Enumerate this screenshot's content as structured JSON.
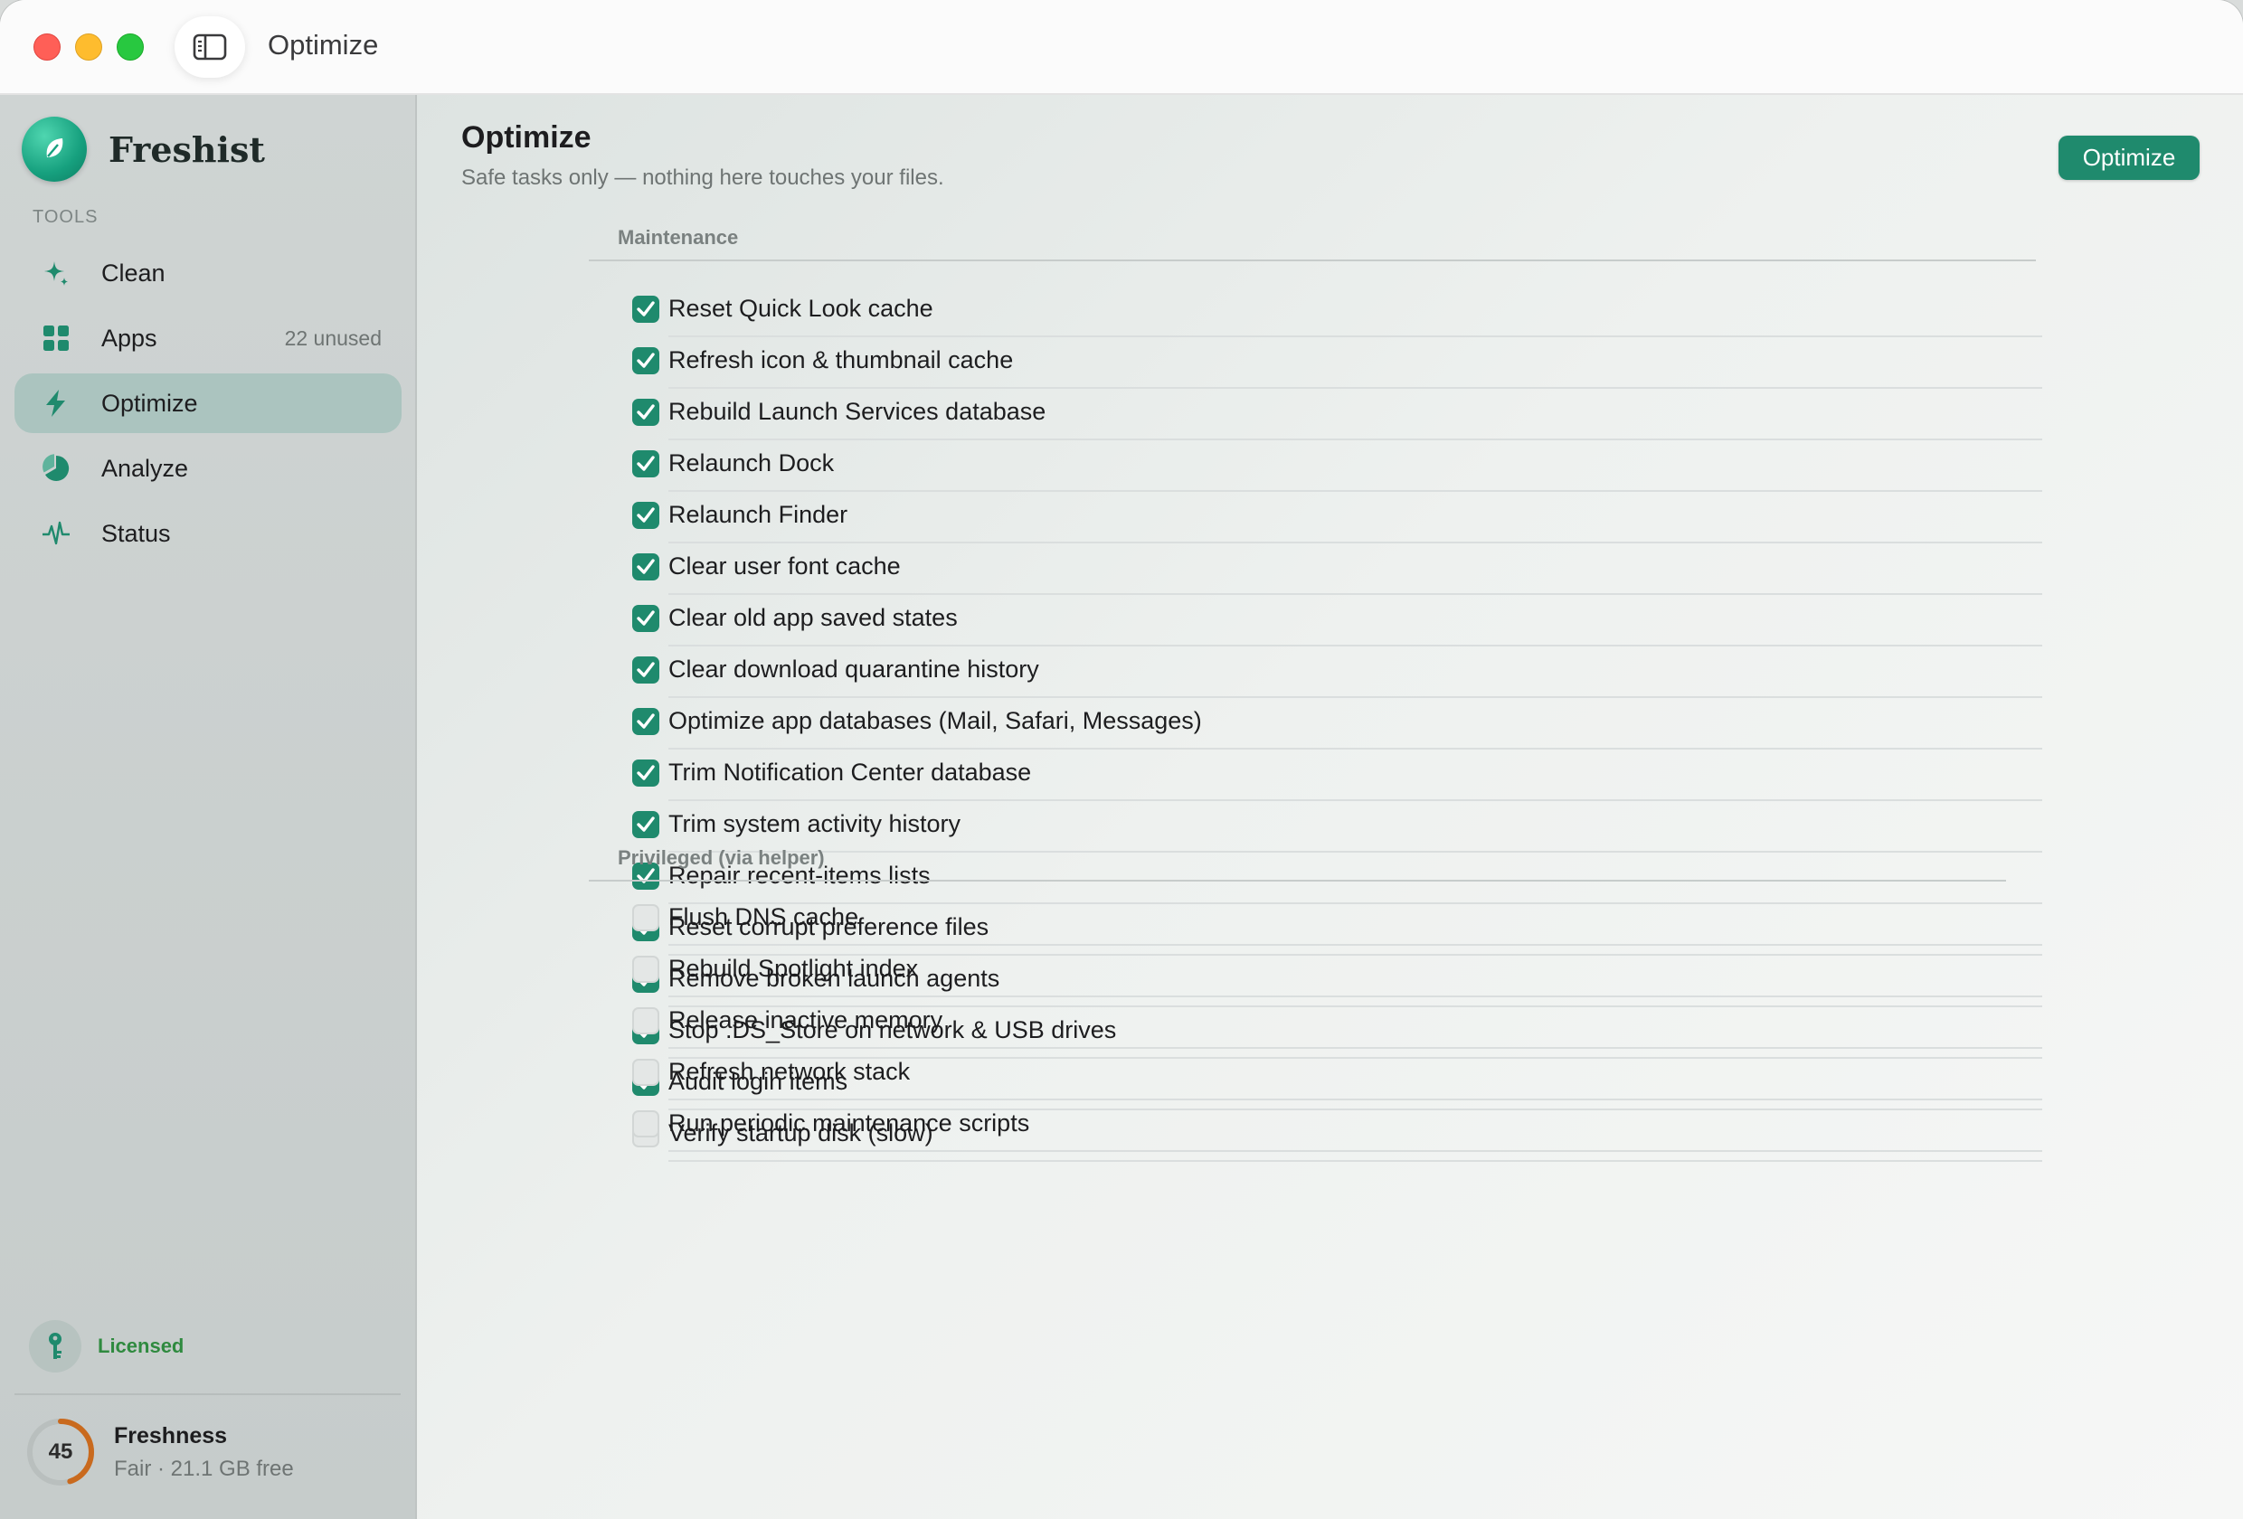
{
  "window": {
    "title": "Optimize"
  },
  "sidebar": {
    "brand": "Freshist",
    "section_label": "TOOLS",
    "items": [
      {
        "label": "Clean",
        "badge": "",
        "icon": "sparkle-icon",
        "active": false
      },
      {
        "label": "Apps",
        "badge": "22 unused",
        "icon": "grid-icon",
        "active": false
      },
      {
        "label": "Optimize",
        "badge": "",
        "icon": "bolt-icon",
        "active": true
      },
      {
        "label": "Analyze",
        "badge": "",
        "icon": "pie-chart-icon",
        "active": false
      },
      {
        "label": "Status",
        "badge": "",
        "icon": "pulse-icon",
        "active": false
      }
    ],
    "license": {
      "label": "Licensed",
      "icon": "key-icon"
    },
    "freshness": {
      "score": "45",
      "score_fraction": 0.45,
      "title": "Freshness",
      "subtitle": "Fair · 21.1 GB free"
    }
  },
  "main": {
    "title": "Optimize",
    "subtitle": "Safe tasks only — nothing here touches your files.",
    "action_label": "Optimize",
    "groups": [
      {
        "header": "Maintenance",
        "tasks": [
          {
            "label": "Reset Quick Look cache",
            "checked": true
          },
          {
            "label": "Refresh icon & thumbnail cache",
            "checked": true
          },
          {
            "label": "Rebuild Launch Services database",
            "checked": true
          },
          {
            "label": "Relaunch Dock",
            "checked": true
          },
          {
            "label": "Relaunch Finder",
            "checked": true
          },
          {
            "label": "Clear user font cache",
            "checked": true
          },
          {
            "label": "Clear old app saved states",
            "checked": true
          },
          {
            "label": "Clear download quarantine history",
            "checked": true
          },
          {
            "label": "Optimize app databases (Mail, Safari, Messages)",
            "checked": true
          },
          {
            "label": "Trim Notification Center database",
            "checked": true
          },
          {
            "label": "Trim system activity history",
            "checked": true
          },
          {
            "label": "Repair recent-items lists",
            "checked": true
          },
          {
            "label": "Reset corrupt preference files",
            "checked": true
          },
          {
            "label": "Remove broken launch agents",
            "checked": true
          },
          {
            "label": "Stop .DS_Store on network & USB drives",
            "checked": true
          },
          {
            "label": "Audit login items",
            "checked": true
          },
          {
            "label": "Verify startup disk (slow)",
            "checked": false
          }
        ]
      },
      {
        "header": "Privileged (via helper)",
        "tasks": [
          {
            "label": "Flush DNS cache",
            "checked": false
          },
          {
            "label": "Rebuild Spotlight index",
            "checked": false
          },
          {
            "label": "Release inactive memory",
            "checked": false
          },
          {
            "label": "Refresh network stack",
            "checked": false
          },
          {
            "label": "Run periodic maintenance scripts",
            "checked": false
          }
        ]
      }
    ]
  },
  "colors": {
    "accent": "#1f8a6d",
    "active_nav": "#abc4bf",
    "licensed": "#2f8a3f",
    "freshness_ring": "#c96a1e"
  }
}
